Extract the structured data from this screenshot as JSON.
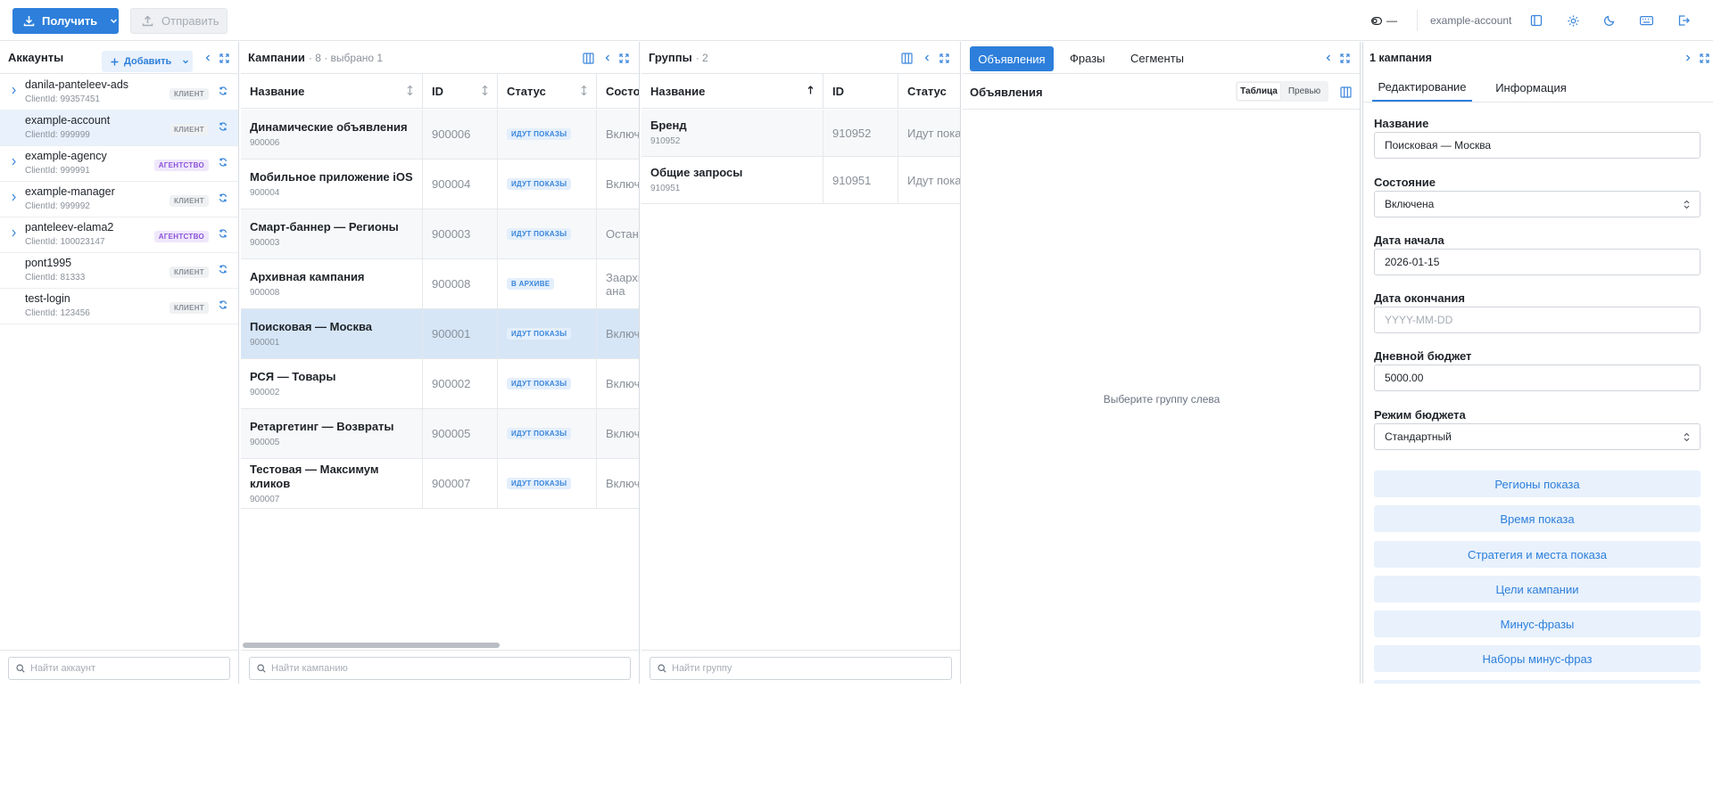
{
  "toolbar": {
    "get_label": "Получить",
    "send_label": "Отправить",
    "status_dash": "—",
    "account_name": "example-account"
  },
  "accounts": {
    "title": "Аккаунты",
    "add_label": "Добавить",
    "search_placeholder": "Найти аккаунт",
    "items": [
      {
        "name": "danila-panteleev-ads",
        "client_id": "ClientId: 99357451",
        "badge": "КЛИЕНТ",
        "expandable": true
      },
      {
        "name": "example-account",
        "client_id": "ClientId: 999999",
        "badge": "КЛИЕНТ",
        "expandable": false
      },
      {
        "name": "example-agency",
        "client_id": "ClientId: 999991",
        "badge": "АГЕНТСТВО",
        "expandable": true
      },
      {
        "name": "example-manager",
        "client_id": "ClientId: 999992",
        "badge": "КЛИЕНТ",
        "expandable": true
      },
      {
        "name": "panteleev-elama2",
        "client_id": "ClientId: 100023147",
        "badge": "АГЕНТСТВО",
        "expandable": true
      },
      {
        "name": "pont1995",
        "client_id": "ClientId: 81333",
        "badge": "КЛИЕНТ",
        "expandable": false
      },
      {
        "name": "test-login",
        "client_id": "ClientId: 123456",
        "badge": "КЛИЕНТ",
        "expandable": false
      }
    ]
  },
  "campaigns": {
    "title": "Кампании",
    "count": "· 8 · выбрано 1",
    "columns": [
      "Название",
      "ID",
      "Статус",
      "Состояние"
    ],
    "search_placeholder": "Найти кампанию",
    "rows": [
      {
        "name": "Динамические объявления",
        "sub": "900006",
        "id": "900006",
        "status": "ИДУТ ПОКАЗЫ",
        "state": "Включена"
      },
      {
        "name": "Мобильное приложение iOS",
        "sub": "900004",
        "id": "900004",
        "status": "ИДУТ ПОКАЗЫ",
        "state": "Включена"
      },
      {
        "name": "Смарт-баннер — Регионы",
        "sub": "900003",
        "id": "900003",
        "status": "ИДУТ ПОКАЗЫ",
        "state": "Остановлена"
      },
      {
        "name": "Архивная кампания",
        "sub": "900008",
        "id": "900008",
        "status": "В АРХИВЕ",
        "state": "Заархивиро",
        "state2": "ана"
      },
      {
        "name": "Поисковая — Москва",
        "sub": "900001",
        "id": "900001",
        "status": "ИДУТ ПОКАЗЫ",
        "state": "Включена"
      },
      {
        "name": "РСЯ — Товары",
        "sub": "900002",
        "id": "900002",
        "status": "ИДУТ ПОКАЗЫ",
        "state": "Включена"
      },
      {
        "name": "Ретаргетинг — Возвраты",
        "sub": "900005",
        "id": "900005",
        "status": "ИДУТ ПОКАЗЫ",
        "state": "Включена"
      },
      {
        "name": "Тестовая — Максимум кликов",
        "sub": "900007",
        "id": "900007",
        "status": "ИДУТ ПОКАЗЫ",
        "state": "Включена"
      }
    ]
  },
  "groups": {
    "title": "Группы",
    "count": "· 2",
    "columns": [
      "Название",
      "ID",
      "Статус"
    ],
    "search_placeholder": "Найти группу",
    "rows": [
      {
        "name": "Бренд",
        "sub": "910952",
        "id": "910952",
        "status": "Идут показы"
      },
      {
        "name": "Общие запросы",
        "sub": "910951",
        "id": "910951",
        "status": "Идут показы"
      }
    ]
  },
  "ads": {
    "tabs": [
      "Объявления",
      "Фразы",
      "Сегменты"
    ],
    "subtitle": "Объявления",
    "view_table": "Таблица",
    "view_preview": "Превью",
    "empty": "Выберите группу слева"
  },
  "editor": {
    "title": "1 кампания",
    "tabs": [
      "Редактирование",
      "Информация"
    ],
    "fields": {
      "name_label": "Название",
      "name_value": "Поисковая — Москва",
      "state_label": "Состояние",
      "state_value": "Включена",
      "start_label": "Дата начала",
      "start_value": "2026-01-15",
      "end_label": "Дата окончания",
      "end_placeholder": "YYYY-MM-DD",
      "budget_label": "Дневной бюджет",
      "budget_value": "5000.00",
      "mode_label": "Режим бюджета",
      "mode_value": "Стандартный"
    },
    "buttons": [
      "Регионы показа",
      "Время показа",
      "Стратегия и места показа",
      "Цели кампании",
      "Минус-фразы",
      "Наборы минус-фраз"
    ]
  },
  "colors": {
    "accent": "#2d7fdb",
    "selected_row": "#d6e6f7",
    "badge_blue": "#3a86db",
    "badge_purple": "#8c52d9"
  }
}
